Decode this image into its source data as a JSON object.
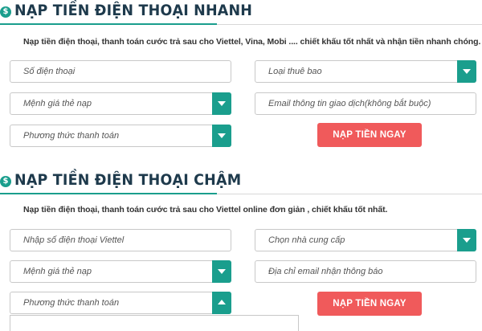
{
  "colors": {
    "accent": "#1a9e8d",
    "cta": "#f05a5b",
    "title": "#1e3a4c"
  },
  "fast": {
    "icon": "dollar-coin-icon",
    "title": "NẠP TIỀN ĐIỆN THOẠI NHANH",
    "description": "Nạp tiền điện thoại, thanh toán cước trả sau cho Viettel, Vina, Mobi .... chiết khấu tốt nhất và nhận tiền nhanh chóng.",
    "phone_placeholder": "Số điện thoại",
    "subscriber_type_placeholder": "Loại thuê bao",
    "card_value_placeholder": "Mệnh giá thẻ nạp",
    "email_placeholder": "Email thông tin giao dịch(không bắt buộc)",
    "payment_method_placeholder": "Phương thức thanh toán",
    "submit_label": "NẠP TIỀN NGAY"
  },
  "slow": {
    "icon": "dollar-coin-icon",
    "title": "NẠP TIỀN ĐIỆN THOẠI CHẬM",
    "description": "Nạp tiền điện thoại, thanh toán cước trả sau cho Viettel online đơn giản , chiết khấu tốt nhất.",
    "phone_placeholder": "Nhập số điện thoại Viettel",
    "provider_placeholder": "Chọn nhà cung cấp",
    "card_value_placeholder": "Mệnh giá thẻ nạp",
    "email_placeholder": "Địa chỉ email nhận thông báo",
    "payment_method_placeholder": "Phương thức thanh toán",
    "submit_label": "NẠP TIỀN NGAY"
  }
}
